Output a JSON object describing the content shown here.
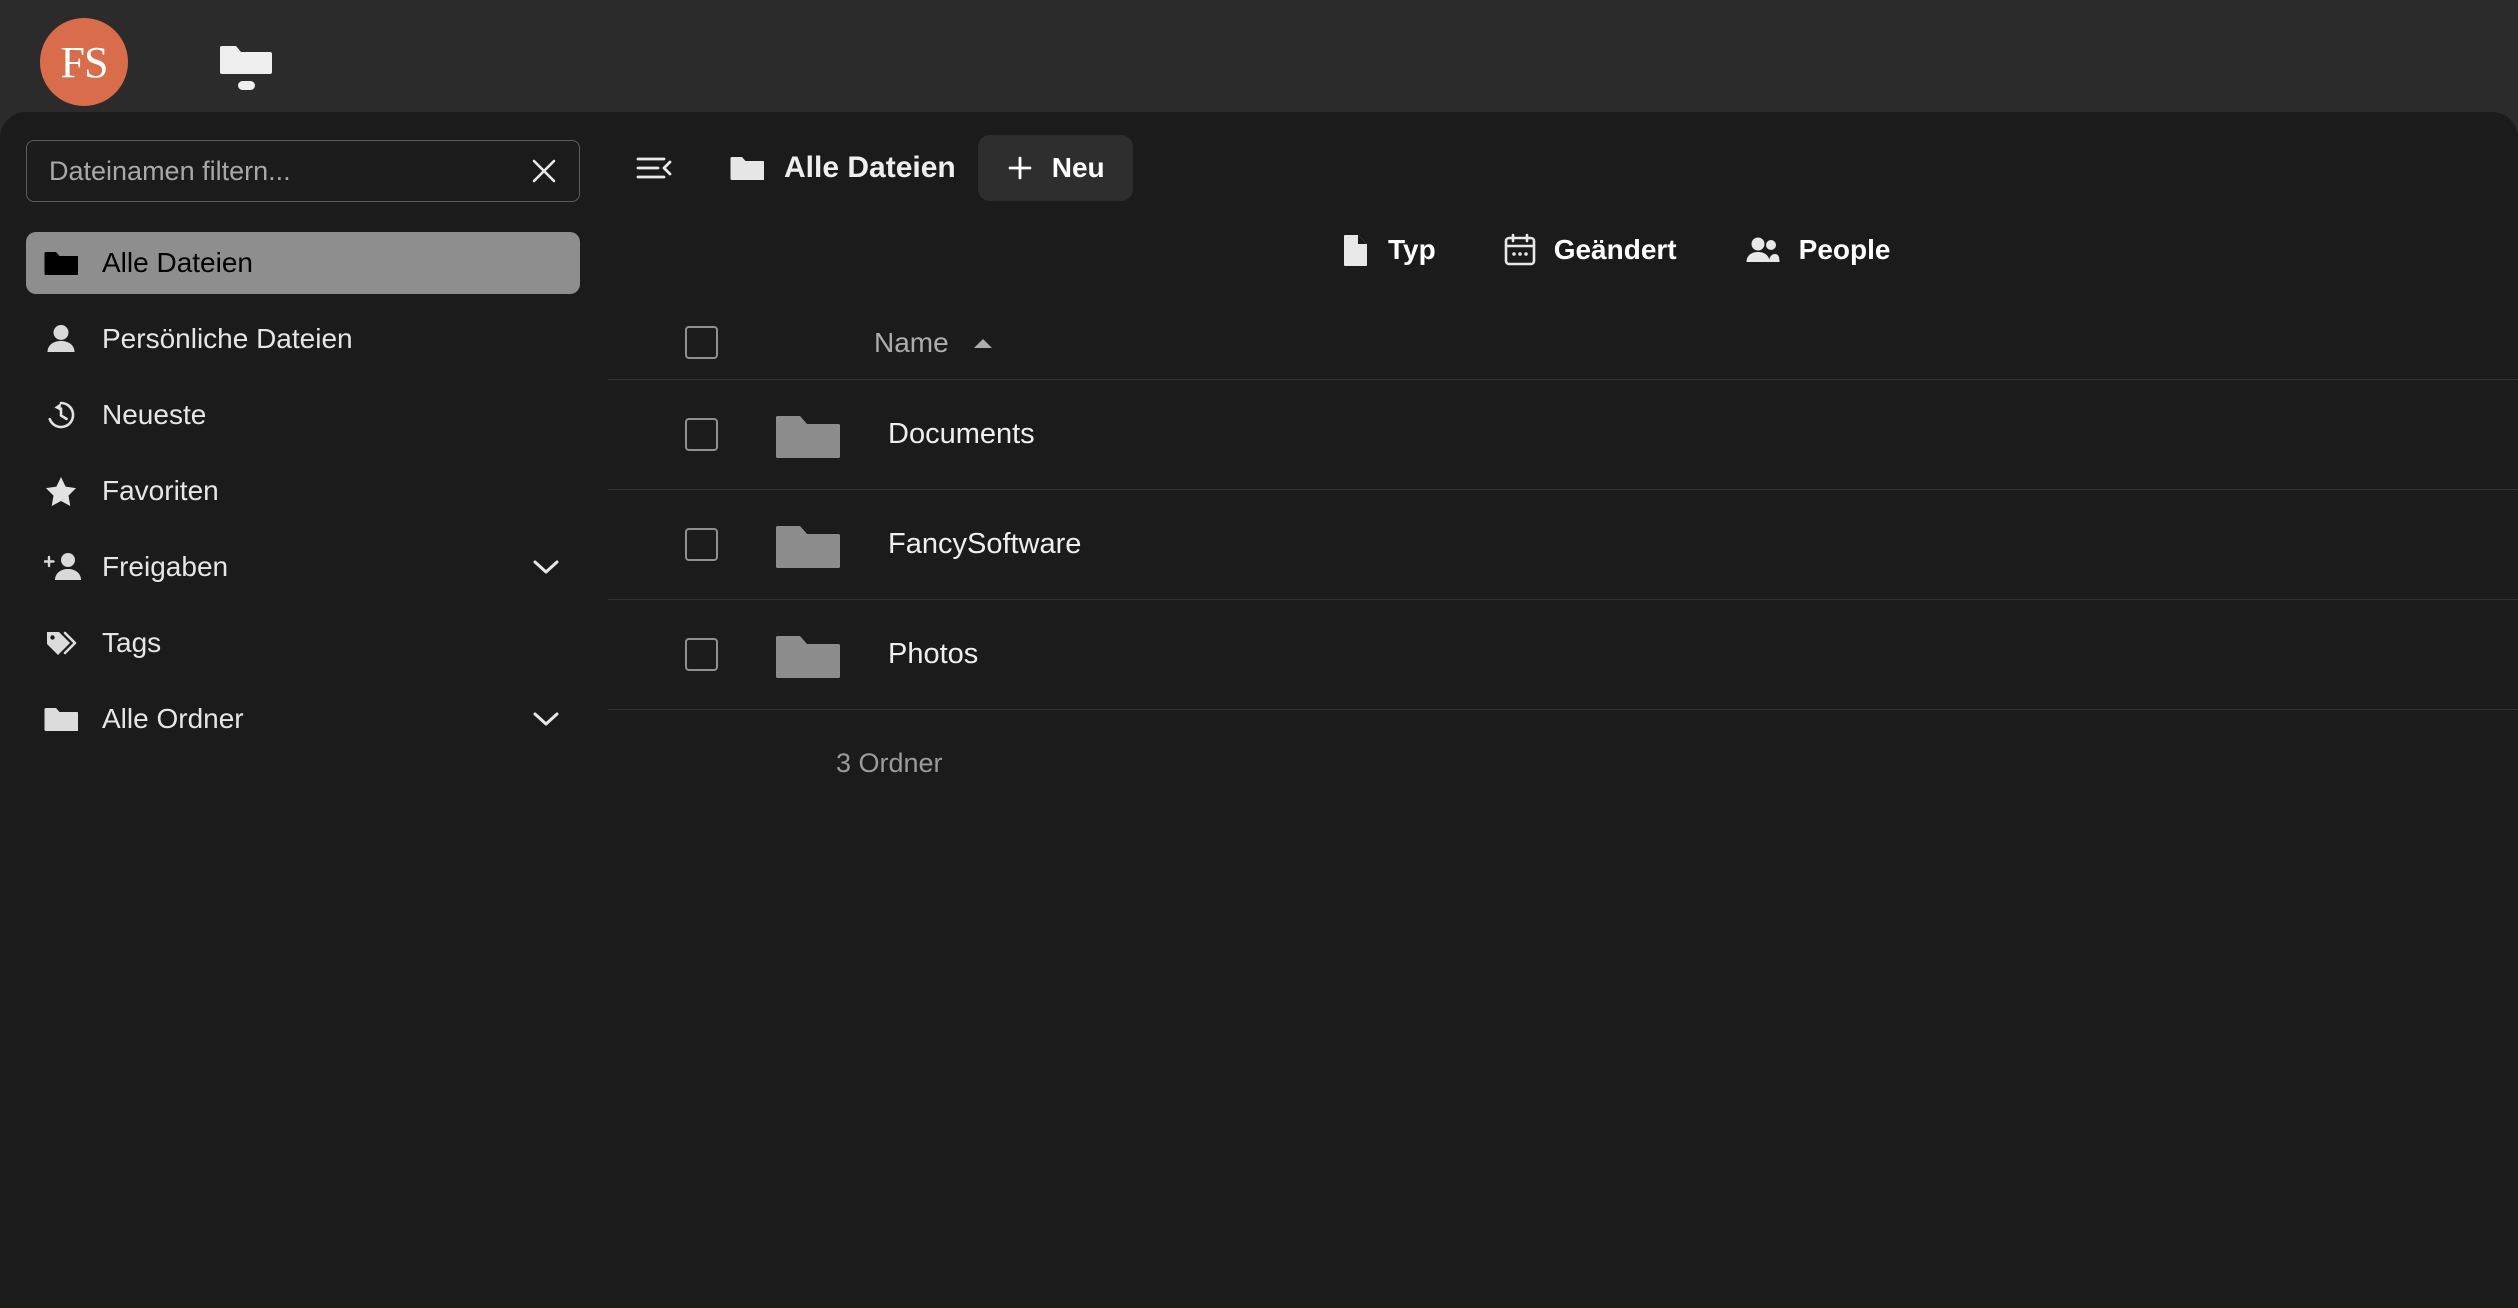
{
  "app": {
    "logo_text": "FS",
    "logo_color": "#d96c4a",
    "topbar_icon": "folder-icon"
  },
  "sidebar": {
    "filter": {
      "placeholder": "Dateinamen filtern...",
      "value": "",
      "clear_icon": "close-icon"
    },
    "items": [
      {
        "label": "Alle Dateien",
        "icon": "folder-icon",
        "active": true,
        "chevron": false
      },
      {
        "label": "Persönliche Dateien",
        "icon": "person-icon",
        "active": false,
        "chevron": false
      },
      {
        "label": "Neueste",
        "icon": "history-icon",
        "active": false,
        "chevron": false
      },
      {
        "label": "Favoriten",
        "icon": "star-icon",
        "active": false,
        "chevron": false
      },
      {
        "label": "Freigaben",
        "icon": "person-add-icon",
        "active": false,
        "chevron": true
      },
      {
        "label": "Tags",
        "icon": "tag-icon",
        "active": false,
        "chevron": false
      },
      {
        "label": "Alle Ordner",
        "icon": "folder-icon",
        "active": false,
        "chevron": true
      }
    ]
  },
  "main": {
    "collapse_icon": "sidebar-collapse-icon",
    "breadcrumb": {
      "icon": "folder-icon",
      "label": "Alle Dateien"
    },
    "new_button": {
      "label": "Neu",
      "icon": "plus-icon"
    },
    "chips": [
      {
        "label": "Typ",
        "icon": "document-icon"
      },
      {
        "label": "Geändert",
        "icon": "calendar-icon"
      },
      {
        "label": "People",
        "icon": "people-icon"
      }
    ],
    "table": {
      "header": {
        "name": "Name",
        "sort_direction": "ascending",
        "sort_icon": "arrow-up-icon",
        "select_all_icon": "checkbox-icon"
      },
      "rows": [
        {
          "name": "Documents",
          "icon": "folder-icon",
          "checked": false
        },
        {
          "name": "FancySoftware",
          "icon": "folder-icon",
          "checked": false
        },
        {
          "name": "Photos",
          "icon": "folder-icon",
          "checked": false
        }
      ],
      "footer": "3 Ordner"
    }
  },
  "colors": {
    "background": "#2b2b2b",
    "panel": "#1b1b1b",
    "accent": "#d96c4a",
    "active_item": "#8e8e8e",
    "folder_icon": "#8d8d8d"
  }
}
